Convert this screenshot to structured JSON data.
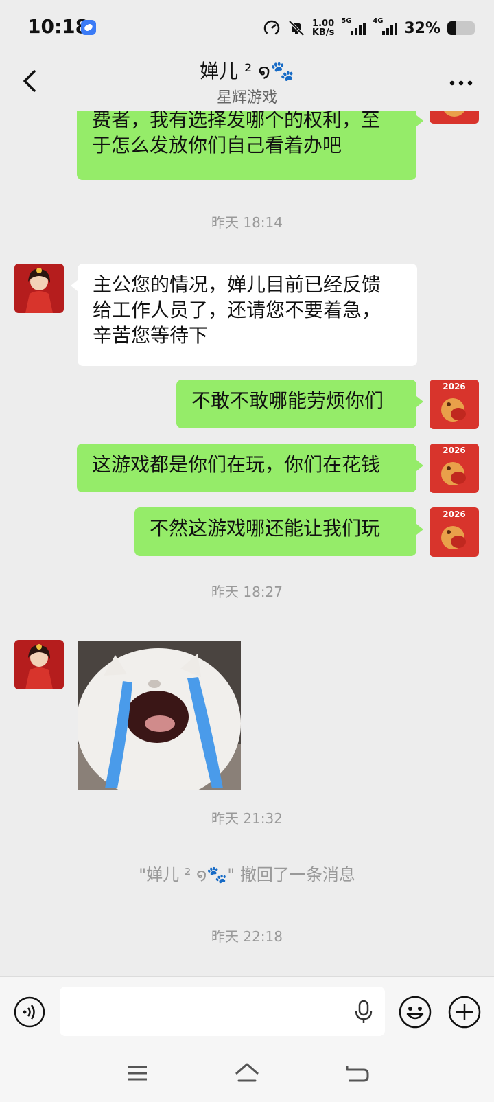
{
  "status_bar": {
    "time": "10:18",
    "net_speed_value": "1.00",
    "net_speed_unit": "KB/s",
    "signal1_label": "5G",
    "signal2_label": "4G",
    "battery_text": "32%",
    "battery_level": 0.32
  },
  "header": {
    "title": "婵儿 ² ໑🐾",
    "subtitle": "星辉游戏"
  },
  "messages": {
    "m1": {
      "line1": "费者，我有选择发哪个的权利，至",
      "line2": "于怎么发放你们自己看着办吧"
    },
    "ts1": "昨天 18:14",
    "m2": {
      "line1": "主公您的情况，婵儿目前已经反馈",
      "line2": "给工作人员了，还请您不要着急，",
      "line3": "辛苦您等待下"
    },
    "m3": "不敢不敢哪能劳烦你们",
    "m4": "这游戏都是你们在玩，你们在花钱",
    "m5": "不然这游戏哪还能让我们玩",
    "ts2": "昨天 18:27",
    "ts3": "昨天 21:32",
    "recall": "\"婵儿 ² ໑🐾\" 撤回了一条消息",
    "ts4": "昨天 22:18"
  },
  "my_avatar_text": "2026",
  "icons": [
    "back-arrow-icon",
    "more-icon",
    "voice-icon",
    "mic-icon",
    "emoji-icon",
    "plus-icon",
    "menu-icon",
    "home-icon",
    "return-icon"
  ],
  "colors": {
    "my_bubble": "#95ec69",
    "their_bubble": "#ffffff",
    "background": "#ededed"
  }
}
